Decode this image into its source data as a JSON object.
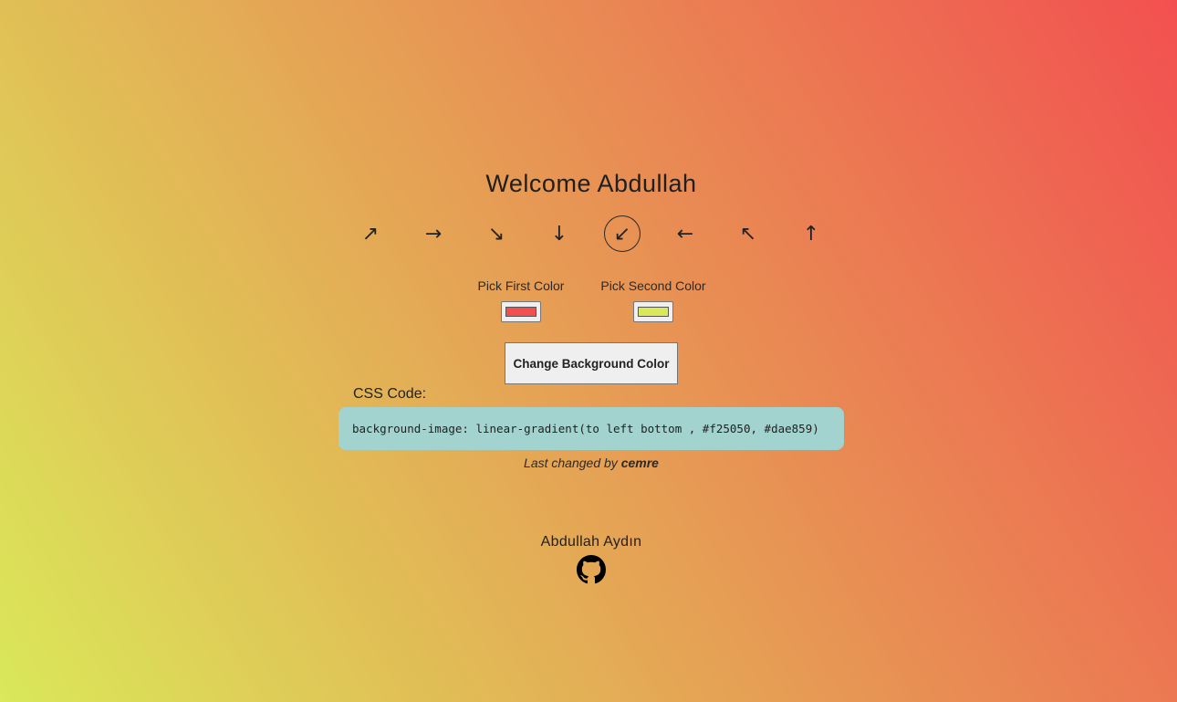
{
  "page": {
    "title": "Welcome Abdullah",
    "gradient": {
      "direction": "to left bottom",
      "from": "#f25050",
      "to": "#dae859"
    }
  },
  "directions": [
    {
      "icon": "arrow-up-right-icon",
      "glyph": "↗",
      "active": false
    },
    {
      "icon": "arrow-right-icon",
      "glyph": "→",
      "active": false
    },
    {
      "icon": "arrow-down-right-icon",
      "glyph": "↘",
      "active": false
    },
    {
      "icon": "arrow-down-icon",
      "glyph": "↓",
      "active": false
    },
    {
      "icon": "arrow-down-left-icon",
      "glyph": "↙",
      "active": true
    },
    {
      "icon": "arrow-left-icon",
      "glyph": "←",
      "active": false
    },
    {
      "icon": "arrow-up-left-icon",
      "glyph": "↖",
      "active": false
    },
    {
      "icon": "arrow-up-icon",
      "glyph": "↑",
      "active": false
    }
  ],
  "pickers": {
    "first": {
      "label": "Pick First Color",
      "value": "#f25050"
    },
    "second": {
      "label": "Pick Second Color",
      "value": "#dae859"
    }
  },
  "button": {
    "label": "Change Background Color"
  },
  "code": {
    "label": "CSS Code:",
    "text": "background-image: linear-gradient(to left bottom , #f25050, #dae859)",
    "box_color": "#a3d3cf"
  },
  "last_changed": {
    "prefix": "Last changed by",
    "user": "cemre"
  },
  "footer": {
    "author": "Abdullah Aydın",
    "icon": "github-icon"
  }
}
